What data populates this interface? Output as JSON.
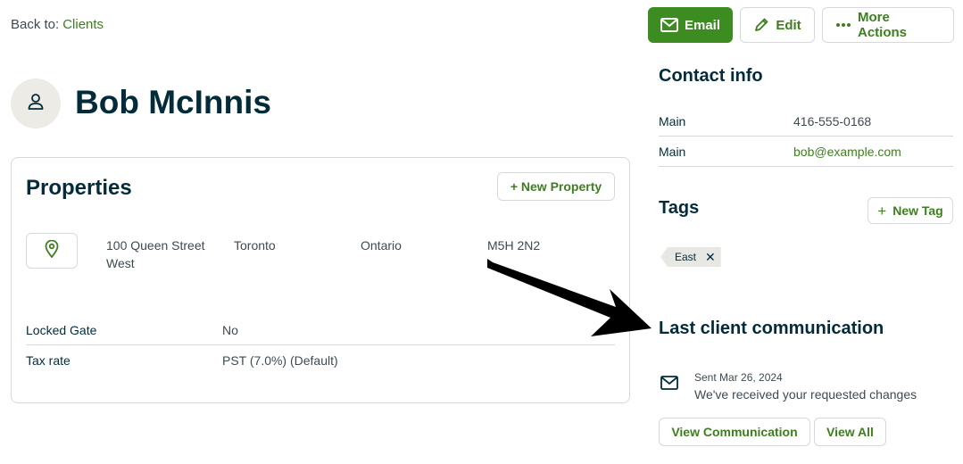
{
  "back": {
    "prefix": "Back to:",
    "link": "Clients"
  },
  "actions": {
    "email": "Email",
    "edit": "Edit",
    "more": "More Actions"
  },
  "client": {
    "name": "Bob McInnis"
  },
  "properties": {
    "title": "Properties",
    "new_button": "+ New Property",
    "address": {
      "street": "100 Queen Street West",
      "city": "Toronto",
      "province": "Ontario",
      "postal": "M5H 2N2"
    },
    "fields": [
      {
        "label": "Locked Gate",
        "value": "No"
      },
      {
        "label": "Tax rate",
        "value": "PST (7.0%) (Default)"
      }
    ]
  },
  "contact": {
    "title": "Contact info",
    "rows": [
      {
        "label": "Main",
        "value": "416-555-0168"
      },
      {
        "label": "Main",
        "value": "bob@example.com"
      }
    ]
  },
  "tags": {
    "title": "Tags",
    "new_button": "New Tag",
    "items": [
      {
        "label": "East"
      }
    ]
  },
  "communication": {
    "title": "Last client communication",
    "sent": "Sent Mar 26, 2024",
    "message": "We've received your requested changes",
    "view_button": "View Communication",
    "view_all_button": "View All"
  },
  "colors": {
    "brand_green": "#3d8c22",
    "link_green": "#3d7f1e",
    "heading": "#032b3a"
  },
  "icons": [
    "person-icon",
    "envelope-icon",
    "pencil-icon",
    "dots-icon",
    "map-pin-icon",
    "close-icon",
    "mail-icon"
  ]
}
